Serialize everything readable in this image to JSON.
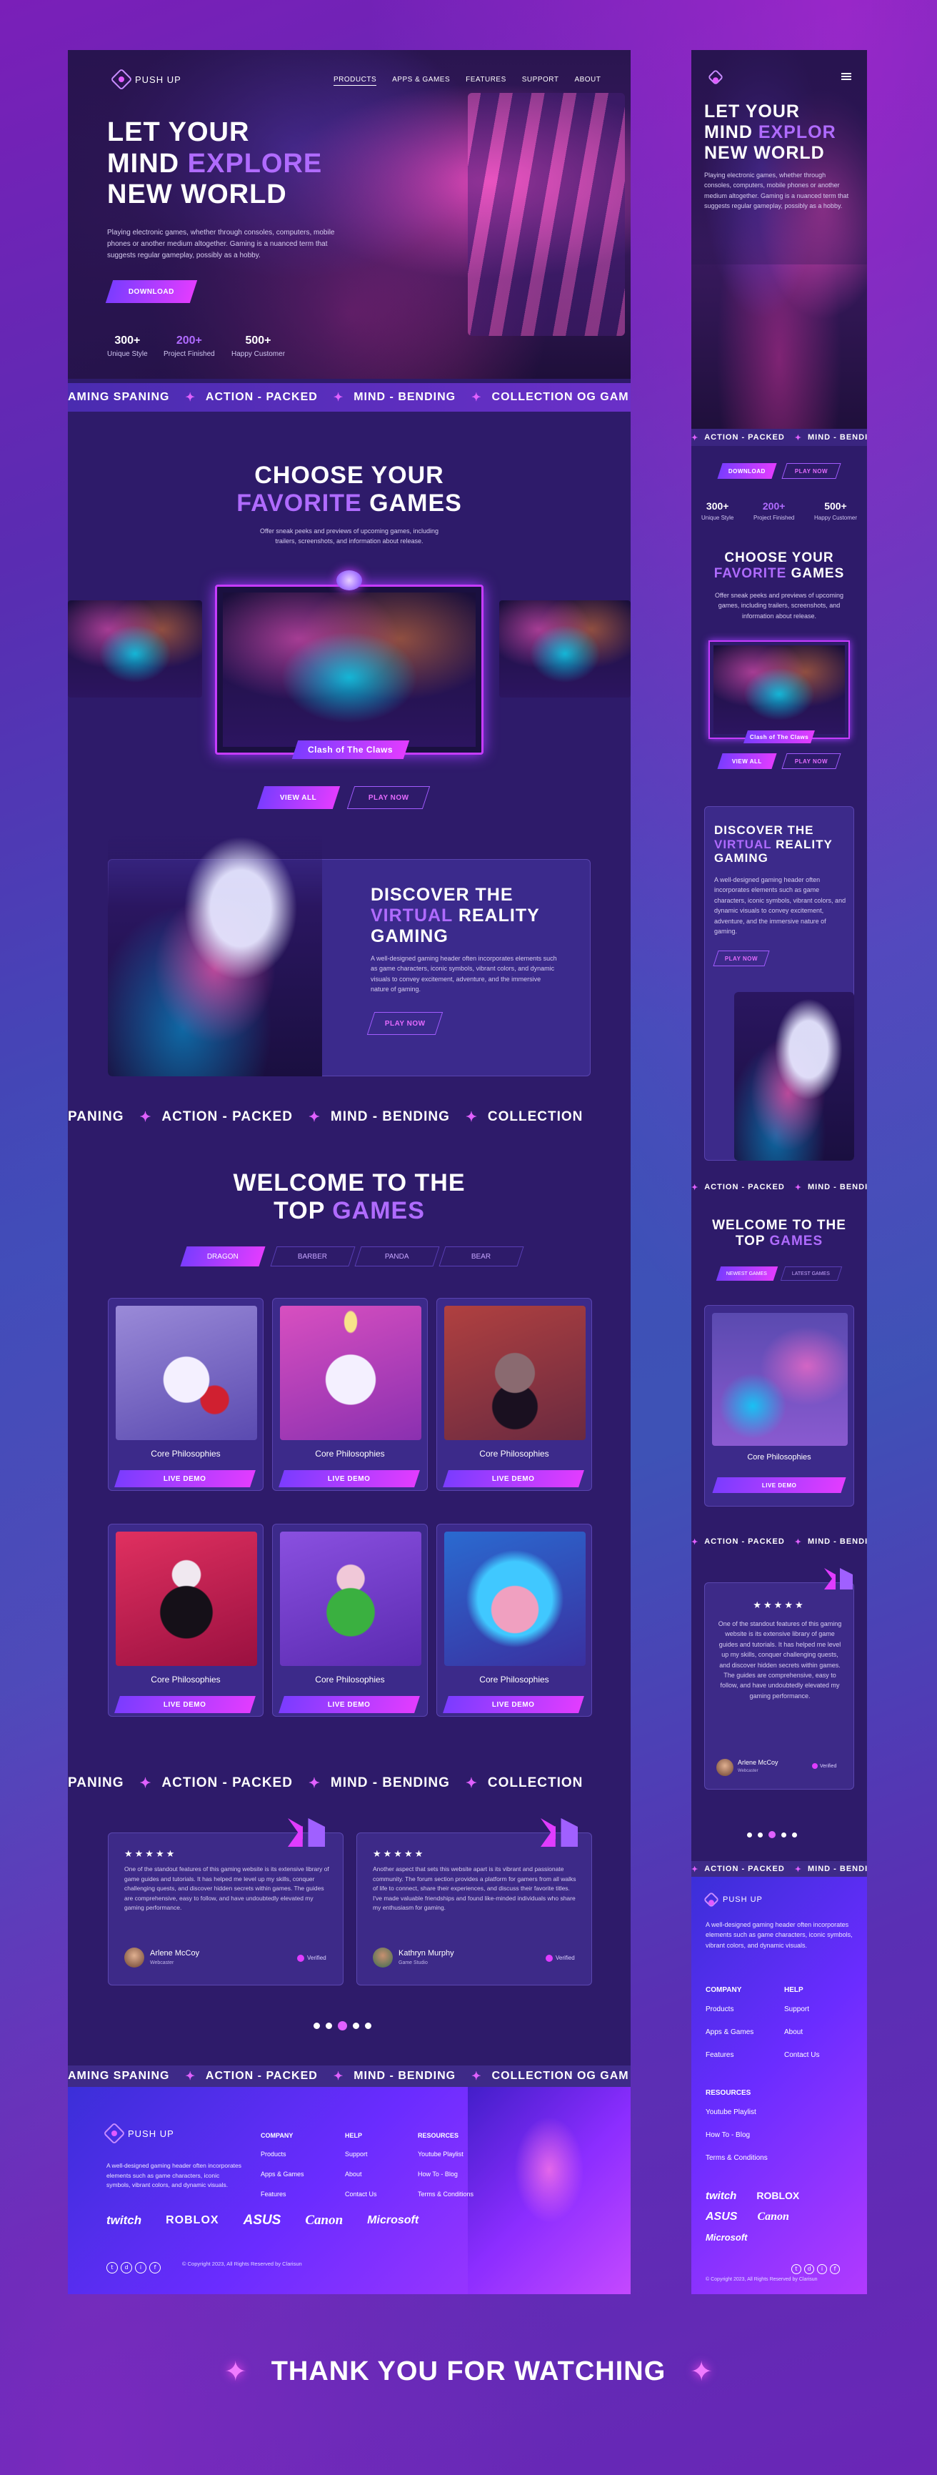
{
  "brand": {
    "name": "PUSH UP"
  },
  "nav": [
    "PRODUCTS",
    "APPS & GAMES",
    "FEATURES",
    "SUPPORT",
    "ABOUT"
  ],
  "hero": {
    "line1": "LET YOUR",
    "line2a": "MIND ",
    "line2b": "EXPLORE",
    "line3": "NEW WORLD",
    "mob_line2b": "EXPLOR",
    "desc": "Playing electronic games, whether through consoles, computers, mobile phones or another medium altogether. Gaming is a nuanced term that suggests regular gameplay, possibly as a hobby.",
    "download": "DOWNLOAD",
    "stats": [
      {
        "n": "300+",
        "l": "Unique Style",
        "accent": false
      },
      {
        "n": "200+",
        "l": "Project Finished",
        "accent": true
      },
      {
        "n": "500+",
        "l": "Happy Customer",
        "accent": false
      }
    ]
  },
  "marquee": {
    "sep": "✦",
    "a": "AMING SPANING",
    "b": "ACTION - PACKED",
    "c": "MIND - BENDING",
    "d": "COLLECTION OG GAM",
    "e": "PANING",
    "f": "COLLECTION"
  },
  "choose": {
    "title1": "CHOOSE YOUR",
    "title2a": "FAVORITE",
    "title2b": " GAMES",
    "desc": "Offer sneak peeks and previews of upcoming games, including trailers, screenshots, and information about release.",
    "caption": "Clash of The Claws",
    "view_all": "VIEW ALL",
    "play_now": "PLAY NOW"
  },
  "vr": {
    "t1": "DISCOVER THE",
    "t2a": "VIRTUAL",
    "t2b": " REALITY",
    "t3": "GAMING",
    "desc": "A well-designed gaming header often incorporates elements such as game characters, iconic symbols, vibrant colors, and dynamic visuals to convey excitement, adventure, and the immersive nature of gaming.",
    "play": "PLAY NOW"
  },
  "welcome": {
    "t1": "WELCOME TO THE",
    "t2a": "TOP ",
    "t2b": "GAMES",
    "tabs": [
      "DRAGON",
      "BARBER",
      "PANDA",
      "BEAR"
    ],
    "mob_tabs": [
      "NEWEST GAMES",
      "LATEST GAMES"
    ],
    "card_title": "Core Philosophies",
    "card_btn": "LIVE DEMO"
  },
  "testimonials": [
    {
      "stars": "★★★★★",
      "text": "One of the standout features of this gaming website is its extensive library of game guides and tutorials. It has helped me level up my skills, conquer challenging quests, and discover hidden secrets within games. The guides are comprehensive, easy to follow, and have undoubtedly elevated my gaming performance.",
      "name": "Arlene McCoy",
      "role": "Webcaster",
      "badge": "Verified"
    },
    {
      "stars": "★★★★★",
      "text": "Another aspect that sets this website apart is its vibrant and passionate community. The forum section provides a platform for gamers from all walks of life to connect, share their experiences, and discuss their favorite titles. I've made valuable friendships and found like-minded individuals who share my enthusiasm for gaming.",
      "name": "Kathryn Murphy",
      "role": "Game Studio",
      "badge": "Verified"
    }
  ],
  "mob_test": {
    "text": "One of the standout features of this gaming website is its extensive library of game guides and tutorials. It has helped me level up my skills, conquer challenging quests, and discover hidden secrets within games. The guides are comprehensive, easy to follow, and have undoubtedly elevated my gaming performance.",
    "role": "Webcaster"
  },
  "footer": {
    "desc": "A well-designed gaming header often incorporates elements such as game characters, iconic symbols, vibrant colors, and dynamic visuals.",
    "company_h": "COMPANY",
    "company": [
      "Products",
      "Apps & Games",
      "Features"
    ],
    "help_h": "HELP",
    "help": [
      "Support",
      "About",
      "Contact Us"
    ],
    "res_h": "RESOURCES",
    "res": [
      "Youtube Playlist",
      "How To - Blog",
      "Terms & Conditions"
    ],
    "brands": [
      "twitch",
      "ROBLOX",
      "ASUS",
      "Canon",
      "Microsoft"
    ],
    "copyright": "© Copyright 2023, All Rights Reserved by Clarisun"
  },
  "outro": {
    "text": "THANK YOU FOR WATCHING",
    "star": "✦"
  },
  "colors": {
    "accent": "#b06bff",
    "pink": "#e23cff",
    "panel": "#2e1b6a"
  }
}
